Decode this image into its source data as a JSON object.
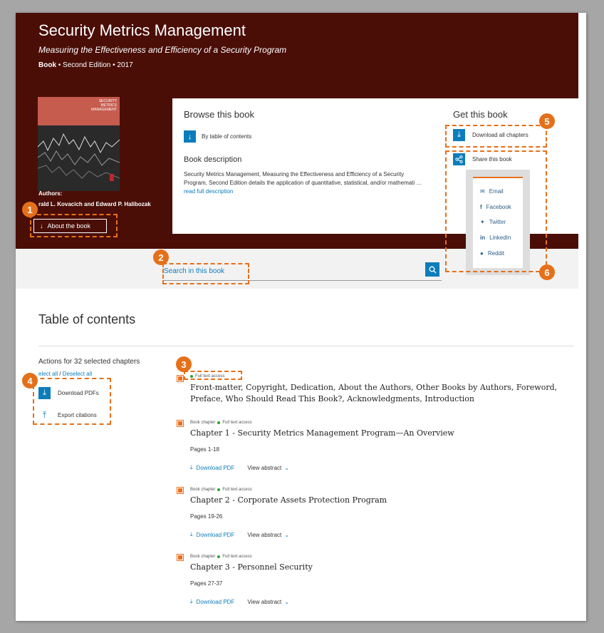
{
  "book": {
    "title": "Security Metrics Management",
    "subtitle": "Measuring the Effectiveness and Efficiency of a Security Program",
    "type": "Book",
    "edition_year": " • Second Edition • 2017",
    "cover_text": "SECURITY METRICS MANAGEMENT",
    "authors_label": "Authors:",
    "authors": "rald L. Kovacich and Edward P. Halibozak",
    "about_button": "About the book"
  },
  "browse": {
    "heading": "Browse this book",
    "toc_link": "By table of contents",
    "desc_heading": "Book description",
    "description": "Security Metrics Management, Measuring the Effectiveness and Efficiency of a Security Program, Second Edition details the application of quantitative, statistical, and/or mathemati …",
    "read_more": "read full description"
  },
  "get": {
    "heading": "Get this book",
    "download_all": "Download all chapters",
    "share": "Share this book",
    "share_items": [
      "Email",
      "Facebook",
      "Twitter",
      "LinkedIn",
      "Reddit"
    ]
  },
  "search": {
    "placeholder": "Search in this book"
  },
  "toc": {
    "heading": "Table of contents",
    "actions_title": "Actions for 32 selected chapters",
    "select_all": "elect all",
    "separator": " / ",
    "deselect_all": "Deselect all",
    "download_pdfs": "Download PDFs",
    "export_citations": "Export citations",
    "full_text": "Full text access",
    "book_chapter": "Book chapter",
    "download_pdf": "Download PDF",
    "view_abstract": "View abstract",
    "front_matter": "Front-matter, Copyright, Dedication, About the Authors, Other Books by Authors, Foreword, Preface, Who Should Read This Book?, Acknowledgments, Introduction",
    "chapters": [
      {
        "title": "Chapter 1 - Security Metrics Management Program—An Overview",
        "pages": "Pages 1-18"
      },
      {
        "title": "Chapter 2 - Corporate Assets Protection Program",
        "pages": "Pages 19-26"
      },
      {
        "title": "Chapter 3 - Personnel Security",
        "pages": "Pages 27-37"
      }
    ]
  },
  "callouts": [
    "1",
    "2",
    "3",
    "4",
    "5",
    "6"
  ],
  "colors": {
    "hero": "#4a0e07",
    "accent": "#e5701a",
    "link": "#0c7dbb"
  },
  "icons": {
    "down_arrow": "arrow-down-icon",
    "download": "download-icon",
    "share": "share-icon",
    "search": "search-icon",
    "export": "upload-icon",
    "chevron": "chevron-down-icon"
  }
}
